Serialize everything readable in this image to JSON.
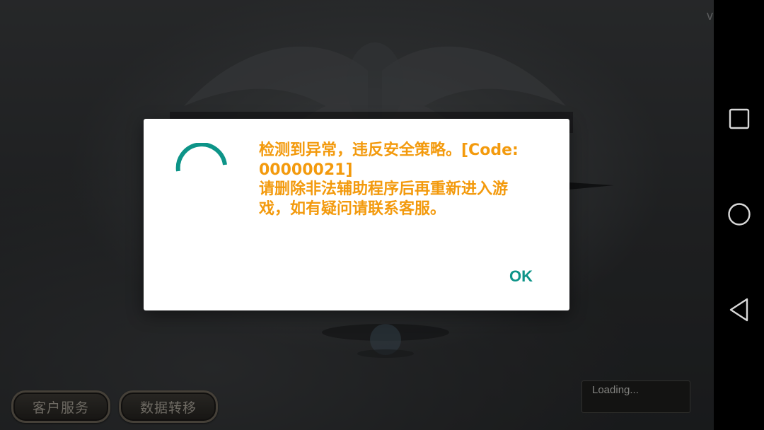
{
  "game": {
    "version_text": "v",
    "buttons": {
      "customer_service": "客户服务",
      "data_transfer": "数据转移"
    },
    "loading_text": "Loading..."
  },
  "dialog": {
    "message_lines": [
      "检测到异常，违反安全策略。[Code:",
      "00000021]",
      "请删除非法辅助程序后再重新进入游",
      "戏，如有疑问请联系客服。"
    ],
    "ok_label": "OK"
  },
  "navbar": {
    "icons": [
      "recents-icon",
      "home-icon",
      "back-icon"
    ]
  },
  "colors": {
    "message_text": "#f39a0d",
    "accent": "#0d9488",
    "dialog_bg": "#ffffff",
    "navbar_bg": "#000000"
  }
}
